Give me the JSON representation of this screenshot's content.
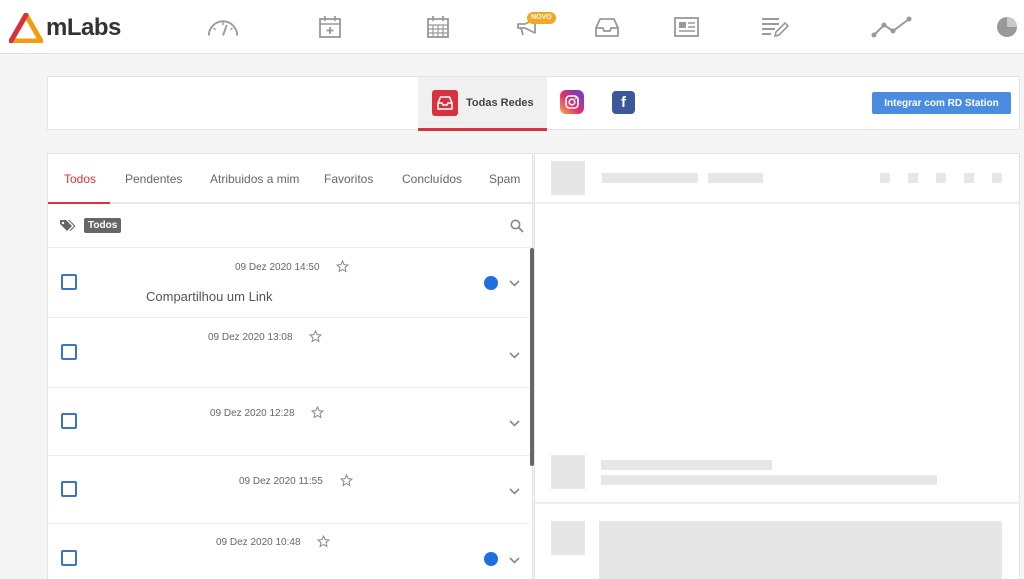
{
  "app": {
    "brand": "mLabs",
    "colors": {
      "accent": "#d8323c",
      "logo_orange": "#f39c12",
      "primary_blue": "#4a8de0",
      "badge": "#f5a623"
    }
  },
  "topnav": {
    "icons": [
      "dashboard-gauge-icon",
      "calendar-add-icon",
      "calendar-grid-icon",
      "megaphone-icon",
      "inbox-icon",
      "newspaper-icon",
      "notes-edit-icon",
      "line-chart-icon",
      "pie-chart-icon"
    ],
    "novo_badge": "NOVO"
  },
  "networks": {
    "all_label": "Todas Redes",
    "integrate_button": "Integrar com RD Station"
  },
  "inbox": {
    "tabs": [
      {
        "label": "Todos",
        "active": true
      },
      {
        "label": "Pendentes",
        "active": false
      },
      {
        "label": "Atribuidos a mim",
        "active": false
      },
      {
        "label": "Favoritos",
        "active": false
      },
      {
        "label": "Concluídos",
        "active": false
      },
      {
        "label": "Spam",
        "active": false
      }
    ],
    "filter_chip": "Todos",
    "items": [
      {
        "timestamp": "09 Dez 2020 14:50",
        "text": "Compartilhou um Link",
        "unread": true
      },
      {
        "timestamp": "09 Dez 2020 13:08",
        "text": "",
        "unread": false
      },
      {
        "timestamp": "09 Dez 2020 12:28",
        "text": "",
        "unread": false
      },
      {
        "timestamp": "09 Dez 2020 11:55",
        "text": "",
        "unread": false
      },
      {
        "timestamp": "09 Dez 2020 10:48",
        "text": "",
        "unread": true
      }
    ]
  }
}
